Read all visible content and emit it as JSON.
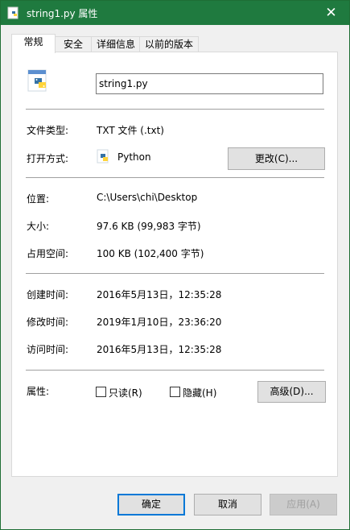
{
  "window": {
    "title": "string1.py 属性",
    "close_symbol": "✕"
  },
  "tabs": [
    {
      "label": "常规"
    },
    {
      "label": "安全"
    },
    {
      "label": "详细信息"
    },
    {
      "label": "以前的版本"
    }
  ],
  "file": {
    "name": "string1.py"
  },
  "props": {
    "type_label": "文件类型:",
    "type_value": "TXT 文件 (.txt)",
    "open_with_label": "打开方式:",
    "open_with_value": "Python",
    "change_button": "更改(C)...",
    "location_label": "位置:",
    "location_value": "C:\\Users\\chi\\Desktop",
    "size_label": "大小:",
    "size_value": "97.6 KB (99,983 字节)",
    "size_on_disk_label": "占用空间:",
    "size_on_disk_value": "100 KB (102,400 字节)",
    "created_label": "创建时间:",
    "created_value": "2016年5月13日，12:35:28",
    "modified_label": "修改时间:",
    "modified_value": "2019年1月10日，23:36:20",
    "accessed_label": "访问时间:",
    "accessed_value": "2016年5月13日，12:35:28",
    "attributes_label": "属性:",
    "readonly_label": "只读(R)",
    "hidden_label": "隐藏(H)",
    "advanced_button": "高级(D)..."
  },
  "footer": {
    "ok": "确定",
    "cancel": "取消",
    "apply": "应用(A)"
  },
  "colors": {
    "titlebar": "#1f7a3f",
    "focus": "#0078d7"
  }
}
